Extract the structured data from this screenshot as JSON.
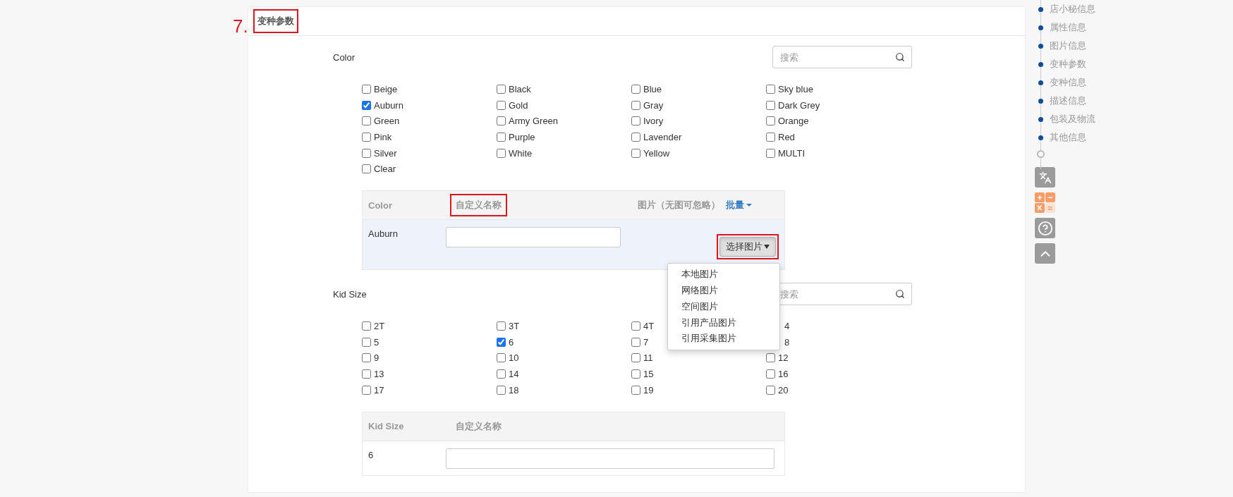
{
  "section": {
    "step": "7.",
    "title": "变种参数",
    "title_highlighted": true
  },
  "groups": [
    {
      "label": "Color",
      "search": {
        "placeholder": "搜索"
      },
      "options": [
        {
          "label": "Beige",
          "checked": false
        },
        {
          "label": "Black",
          "checked": false
        },
        {
          "label": "Blue",
          "checked": false
        },
        {
          "label": "Sky blue",
          "checked": false
        },
        {
          "label": "Auburn",
          "checked": true
        },
        {
          "label": "Gold",
          "checked": false
        },
        {
          "label": "Gray",
          "checked": false
        },
        {
          "label": "Dark Grey",
          "checked": false
        },
        {
          "label": "Green",
          "checked": false
        },
        {
          "label": "Army Green",
          "checked": false
        },
        {
          "label": "Ivory",
          "checked": false
        },
        {
          "label": "Orange",
          "checked": false
        },
        {
          "label": "Pink",
          "checked": false
        },
        {
          "label": "Purple",
          "checked": false
        },
        {
          "label": "Lavender",
          "checked": false
        },
        {
          "label": "Red",
          "checked": false
        },
        {
          "label": "Silver",
          "checked": false
        },
        {
          "label": "White",
          "checked": false
        },
        {
          "label": "Yellow",
          "checked": false
        },
        {
          "label": "MULTI",
          "checked": false
        },
        {
          "label": "Clear",
          "checked": false
        }
      ],
      "table": {
        "columns": [
          {
            "label": "Color",
            "highlighted": false
          },
          {
            "label": "自定义名称",
            "highlighted": true
          },
          {
            "label": "图片（无图可忽略）",
            "highlighted": false
          }
        ],
        "batch_link": "批量",
        "rows": [
          {
            "value": "Auburn",
            "image_button": {
              "label": "选择图片",
              "highlighted": true,
              "expanded": true,
              "menu": [
                "本地图片",
                "网络图片",
                "空间图片",
                "引用产品图片",
                "引用采集图片"
              ]
            }
          }
        ]
      }
    },
    {
      "label": "Kid Size",
      "search": {
        "placeholder": "搜索"
      },
      "options": [
        {
          "label": "2T",
          "checked": false
        },
        {
          "label": "3T",
          "checked": false
        },
        {
          "label": "4T",
          "checked": false
        },
        {
          "label": "4"
        },
        {
          "label": "5",
          "checked": false
        },
        {
          "label": "6",
          "checked": true
        },
        {
          "label": "7",
          "checked": false
        },
        {
          "label": "8"
        },
        {
          "label": "9",
          "checked": false
        },
        {
          "label": "10",
          "checked": false
        },
        {
          "label": "11",
          "checked": false
        },
        {
          "label": "12",
          "checked": false
        },
        {
          "label": "13",
          "checked": false
        },
        {
          "label": "14",
          "checked": false
        },
        {
          "label": "15",
          "checked": false
        },
        {
          "label": "16",
          "checked": false
        },
        {
          "label": "17",
          "checked": false
        },
        {
          "label": "18",
          "checked": false
        },
        {
          "label": "19",
          "checked": false
        },
        {
          "label": "20",
          "checked": false
        }
      ],
      "table": {
        "columns": [
          {
            "label": "Kid Size",
            "highlighted": false
          },
          {
            "label": "自定义名称",
            "highlighted": false
          }
        ],
        "rows": [
          {
            "value": "6"
          }
        ]
      }
    }
  ],
  "nav": {
    "items": [
      "店小秘信息",
      "属性信息",
      "图片信息",
      "变种参数",
      "变种信息",
      "描述信息",
      "包装及物流",
      "其他信息"
    ],
    "tools": [
      {
        "kind": "translate"
      },
      {
        "kind": "calculator"
      },
      {
        "kind": "help"
      },
      {
        "kind": "top"
      }
    ]
  }
}
